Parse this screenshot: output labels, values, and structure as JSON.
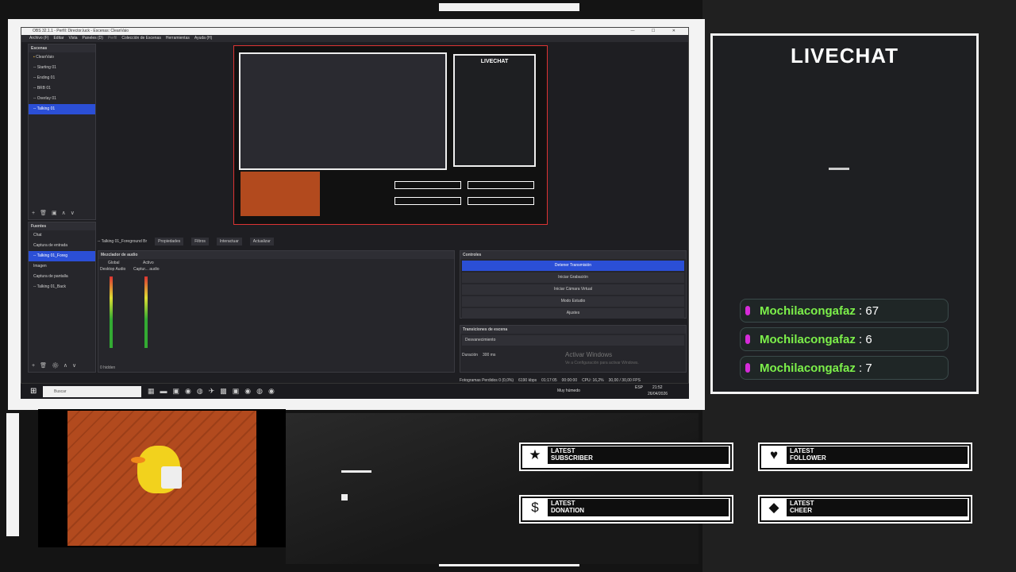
{
  "obs": {
    "title": "OBS 32.1.1 - Perfil: Director.luck - Escenas: CleanVaio",
    "menu": [
      "Archivo (F)",
      "Editar",
      "Vista",
      "Paneles (D)",
      "Perfil",
      "Colección de Escenas",
      "Herramientas",
      "Ayuda (H)"
    ],
    "scenes": {
      "title": "Escenas",
      "items": [
        "CleanVaio",
        "-- Starting 01",
        "-- Ending 01",
        "-- BRB 01",
        "-- Overlay 01",
        "-- Talking 01"
      ],
      "selected_index": 5
    },
    "sources": {
      "title": "Fuentes",
      "items": [
        "Chat",
        "Captura de entrada",
        "-- Talking 01_Foreg",
        "Imagen",
        "Captura de pantalla",
        "-- Talking 01_Back"
      ],
      "selected_index": 2
    },
    "toolbar": {
      "selected_source": "-- Talking 01_Foreground Br",
      "properties": "Propiedades",
      "filters": "Filtros",
      "interact": "Interactuar",
      "refresh": "Actualizar"
    },
    "audio_mixer": {
      "title": "Mezclador de audio",
      "tab_global": "Global",
      "tab_active": "Activo",
      "channel1": "Desktop Audio",
      "channel2": "Captur... audio",
      "hidden": "0 hidden"
    },
    "controls": {
      "title": "Controles",
      "buttons": [
        "Detener Transmisión",
        "Iniciar Grabación",
        "Iniciar Cámara Virtual",
        "Modo Estudio",
        "Ajustes"
      ]
    },
    "transitions": {
      "title": "Transiciones de escena",
      "selected": "Desvanecimiento",
      "duration_label": "Duración",
      "duration_value": "300 ms"
    },
    "status": {
      "dropped": "Fotogramas Perdidos 0 (0,0%)",
      "kbps": "6190 kbps",
      "time": "01:17:05",
      "rec": "00:00:00",
      "cpu": "CPU: 16,2%",
      "fps": "30,00 / 30,00 FPS"
    },
    "watermark": {
      "line1": "Activar Windows",
      "line2": "Ve a Configuración para activar Windows."
    },
    "taskbar": {
      "search": "Buscar",
      "weather": "Muy húmedo",
      "lang": "ESP",
      "clock": "21:52",
      "date": "26/04/2026"
    }
  },
  "livechat": {
    "title": "LIVECHAT",
    "messages": [
      {
        "user": "Mochilacongafaz",
        "value": "67"
      },
      {
        "user": "Mochilacongafaz",
        "value": "6"
      },
      {
        "user": "Mochilacongafaz",
        "value": "7"
      }
    ]
  },
  "alerts": [
    {
      "label": "LATEST\nSUBSCRIBER",
      "icon": "star-icon"
    },
    {
      "label": "LATEST\nFOLLOWER",
      "icon": "heart-icon"
    },
    {
      "label": "LATEST\nDONATION",
      "icon": "dollar-icon"
    },
    {
      "label": "LATEST\nCHEER",
      "icon": "diamond-icon"
    }
  ],
  "colors": {
    "accent_blue": "#2b4fd6",
    "chat_name_green": "#7cf04a",
    "mic_magenta": "#d52bd9",
    "frame_white": "#f3f3f3"
  }
}
